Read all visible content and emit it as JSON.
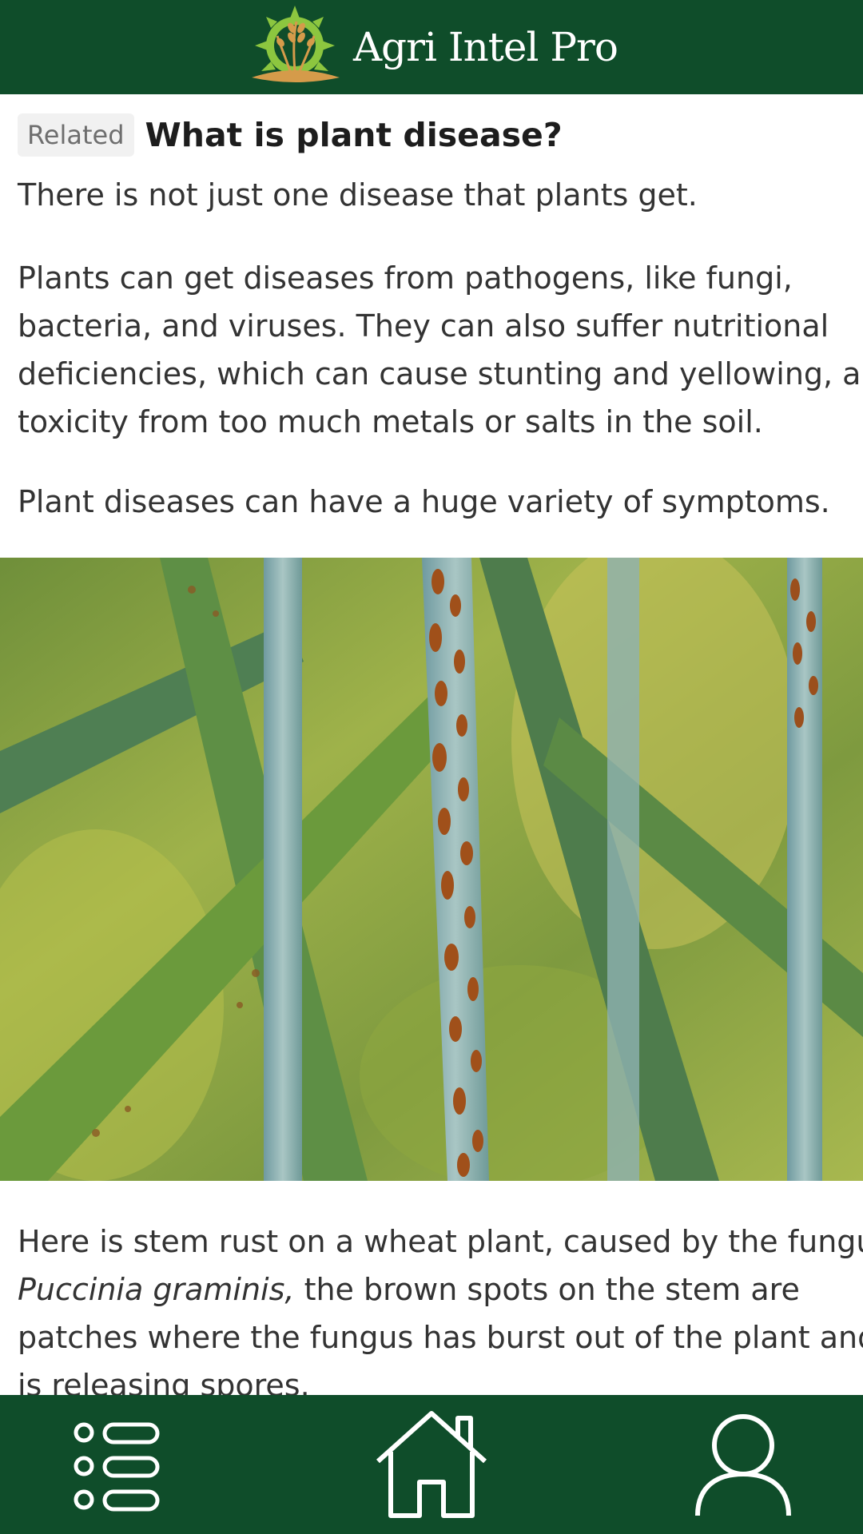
{
  "app": {
    "title": "Agri Intel Pro",
    "brand_color": "#0f4d2a",
    "logo_icon": "wheat-sun-logo-icon"
  },
  "article": {
    "tag": "Related",
    "heading": "What is plant disease?",
    "paragraphs": [
      "There is not just one disease that plants get.",
      "Plants can get diseases from pathogens, like fungi, bacteria, and viruses. They can also suffer nutritional deficiencies, which can cause stunting and yellowing, and toxicity from too much metals or salts in the soil.",
      "Plant diseases can have a huge variety of symptoms."
    ],
    "image_subject": "wheat stem with stem rust",
    "caption": {
      "lines": [
        "Here is stem rust on a wheat plant, caused by the fungus",
        "the brown spots on the stem are",
        "patches where the fungus has burst out of the plant and",
        "is releasing spores."
      ],
      "species": "Puccinia graminis,"
    },
    "para_lines": {
      "p2": [
        "Plants can get diseases from pathogens, like fungi,",
        "bacteria, and viruses. They can also suffer nutritional",
        "deficiencies, which can cause stunting and yellowing, and",
        "toxicity from too much metals or salts in the soil."
      ]
    }
  },
  "nav": {
    "items": [
      {
        "icon": "list-menu-icon"
      },
      {
        "icon": "home-icon"
      },
      {
        "icon": "user-profile-icon"
      }
    ]
  }
}
